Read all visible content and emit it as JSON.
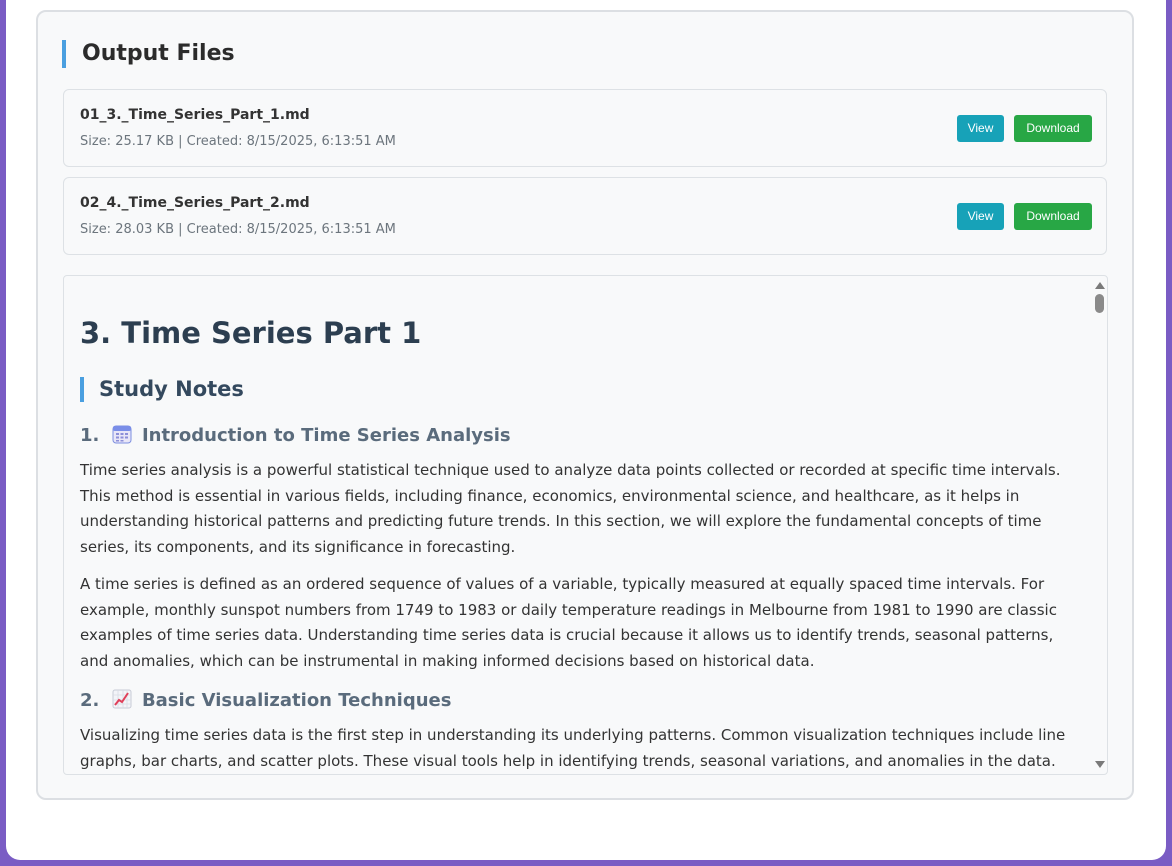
{
  "output_files": {
    "title": "Output Files",
    "files": [
      {
        "name": "01_3._Time_Series_Part_1.md",
        "meta": "Size: 25.17 KB | Created: 8/15/2025, 6:13:51 AM",
        "view_label": "View",
        "download_label": "Download"
      },
      {
        "name": "02_4._Time_Series_Part_2.md",
        "meta": "Size: 28.03 KB | Created: 8/15/2025, 6:13:51 AM",
        "view_label": "View",
        "download_label": "Download"
      }
    ]
  },
  "preview": {
    "title": "3. Time Series Part 1",
    "subtitle": "Study Notes",
    "sections": [
      {
        "number": "1.",
        "icon": "calendar-icon",
        "heading": "Introduction to Time Series Analysis",
        "paragraphs": [
          "Time series analysis is a powerful statistical technique used to analyze data points collected or recorded at specific time intervals. This method is essential in various fields, including finance, economics, environmental science, and healthcare, as it helps in understanding historical patterns and predicting future trends. In this section, we will explore the fundamental concepts of time series, its components, and its significance in forecasting.",
          "A time series is defined as an ordered sequence of values of a variable, typically measured at equally spaced time intervals. For example, monthly sunspot numbers from 1749 to 1983 or daily temperature readings in Melbourne from 1981 to 1990 are classic examples of time series data. Understanding time series data is crucial because it allows us to identify trends, seasonal patterns, and anomalies, which can be instrumental in making informed decisions based on historical data."
        ]
      },
      {
        "number": "2.",
        "icon": "chart-increasing-icon",
        "heading": "Basic Visualization Techniques",
        "paragraphs": [
          "Visualizing time series data is the first step in understanding its underlying patterns. Common visualization techniques include line graphs, bar charts, and scatter plots. These visual tools help in identifying trends, seasonal variations, and anomalies in the data."
        ]
      }
    ]
  },
  "colors": {
    "accent": "#4a9fe0",
    "view_button": "#17a2b8",
    "download_button": "#28a745",
    "page_background": "#7a5cc4"
  }
}
